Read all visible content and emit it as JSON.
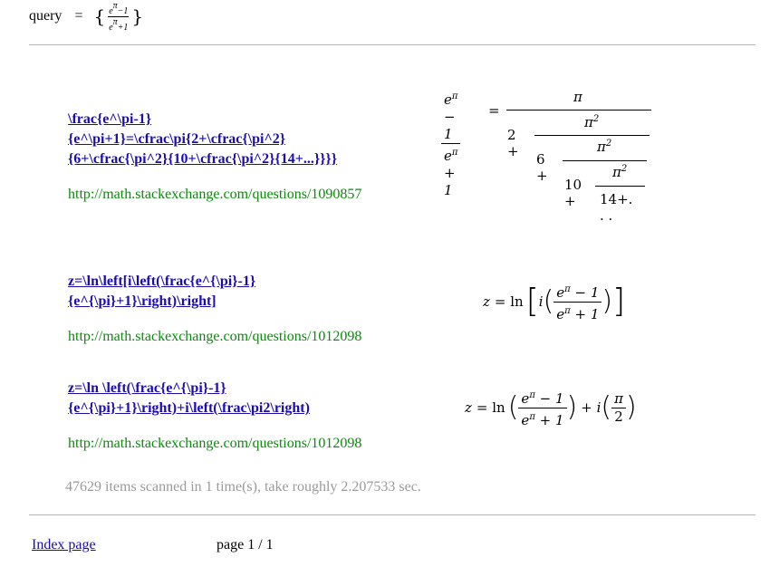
{
  "query": {
    "label": "query",
    "equals": "=",
    "open_brace": "{",
    "close_brace": "}",
    "num": "eπ−1",
    "den": "eπ+1"
  },
  "results": [
    {
      "link_lines": [
        "\\frac{e^\\pi-1}",
        "{e^\\pi+1}=\\cfrac\\pi{2+\\cfrac{\\pi^2}",
        "{6+\\cfrac{\\pi^2}{10+\\cfrac{\\pi^2}{14+...}}}}"
      ],
      "url": "http://math.stackexchange.com/questions/1090857",
      "formula": {
        "lhs_num": "eπ − 1",
        "lhs_den": "eπ + 1",
        "eq": "=",
        "pi": "π",
        "t1": "2 +",
        "pi2": "π2",
        "t2": "6 +",
        "t3": "10 +",
        "tail": "14+. . ."
      }
    },
    {
      "link_lines": [
        "z=\\ln\\left[i\\left(\\frac{e^{\\pi}-1}",
        "{e^{\\pi}+1}\\right)\\right]"
      ],
      "url": "http://math.stackexchange.com/questions/1012098",
      "formula": {
        "z": "z",
        "eq_ln": "= ln",
        "lb": "[",
        "i": "i",
        "lp": "(",
        "num": "eπ − 1",
        "den": "eπ + 1",
        "rp": ")",
        "rb": "]"
      }
    },
    {
      "link_lines": [
        "z=\\ln \\left(\\frac{e^{\\pi}-1}",
        "{e^{\\pi}+1}\\right)+i\\left(\\frac\\pi2\\right)"
      ],
      "url": "http://math.stackexchange.com/questions/1012098",
      "formula": {
        "z": "z",
        "eq_ln": "= ln",
        "lp": "(",
        "num": "eπ − 1",
        "den": "eπ + 1",
        "rp": ")",
        "plus_i": "+ i",
        "lp2": "(",
        "pi": "π",
        "two": "2",
        "rp2": ")"
      }
    }
  ],
  "stats": "47629 items scanned in 1 time(s), take roughly 2.207533 sec.",
  "footer": {
    "index_link": "Index page",
    "page": "page 1 / 1"
  }
}
